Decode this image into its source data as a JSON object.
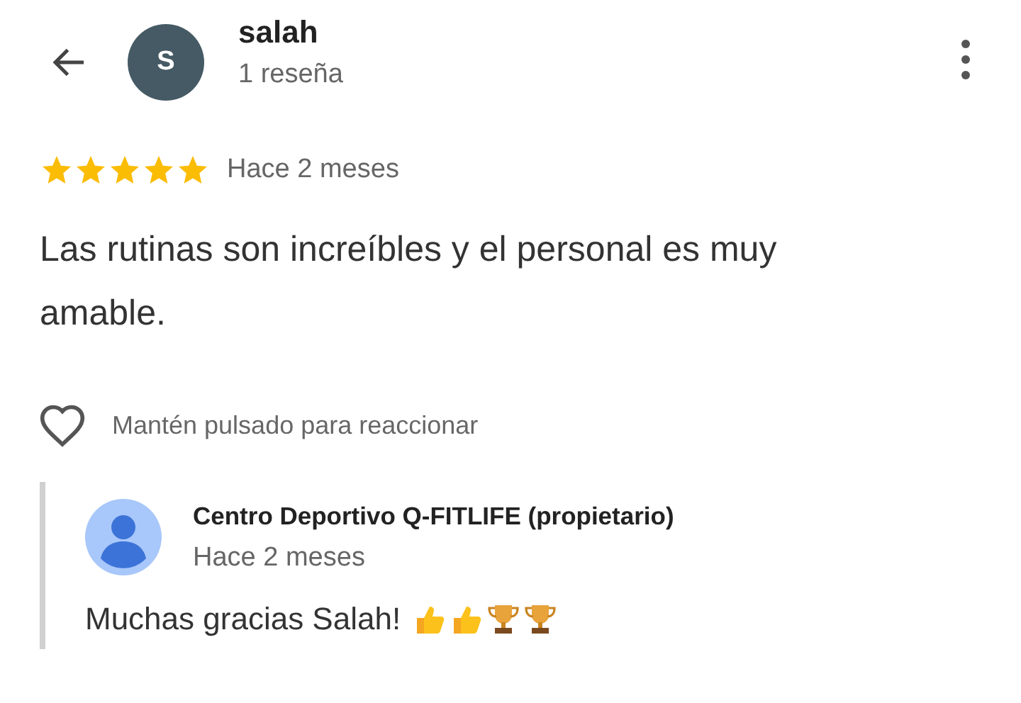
{
  "header": {
    "avatar_letter": "S",
    "name": "salah",
    "subtitle": "1 reseña"
  },
  "review": {
    "stars": 5,
    "date": "Hace 2 meses",
    "text": "Las rutinas son increíbles y el personal es muy amable."
  },
  "reaction": {
    "liked": false,
    "hint": "Mantén pulsado para reaccionar"
  },
  "owner_reply": {
    "name": "Centro Deportivo Q-FITLIFE (propietario)",
    "date": "Hace 2 meses",
    "text": "Muchas gracias Salah!",
    "emoji": [
      {
        "kind": "thumbs_up"
      },
      {
        "kind": "thumbs_up"
      },
      {
        "kind": "trophy"
      },
      {
        "kind": "trophy"
      }
    ]
  }
}
